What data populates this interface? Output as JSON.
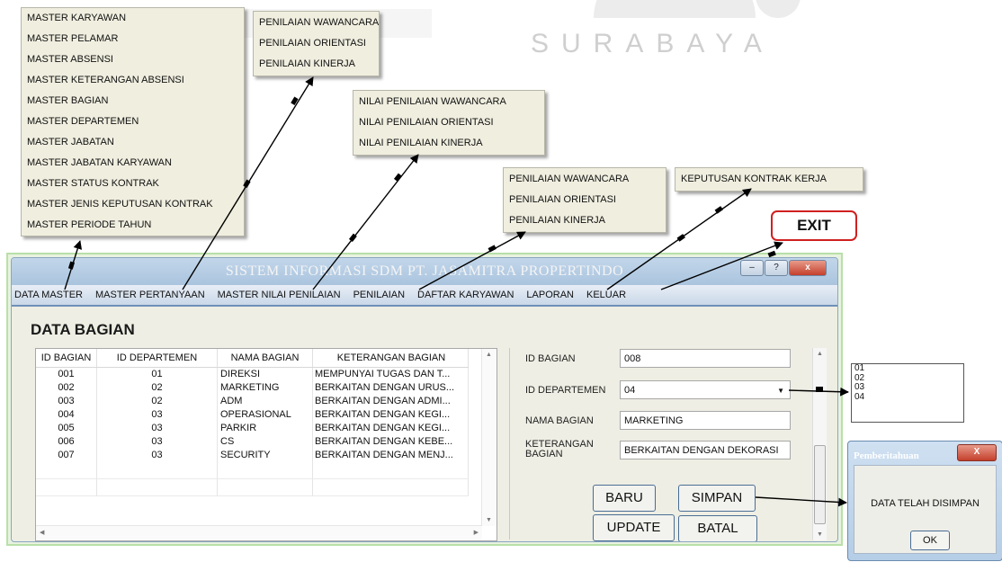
{
  "watermark": {
    "text": "SURABAYA"
  },
  "menus": {
    "master": [
      "MASTER KARYAWAN",
      "MASTER PELAMAR",
      "MASTER ABSENSI",
      "MASTER KETERANGAN ABSENSI",
      "MASTER BAGIAN",
      "MASTER DEPARTEMEN",
      "MASTER JABATAN",
      "MASTER JABATAN KARYAWAN",
      "MASTER STATUS KONTRAK",
      "MASTER JENIS KEPUTUSAN KONTRAK",
      "MASTER PERIODE TAHUN"
    ],
    "pertanyaan": [
      "PENILAIAN WAWANCARA",
      "PENILAIAN ORIENTASI",
      "PENILAIAN KINERJA"
    ],
    "nilai_penilaian": [
      "NILAI PENILAIAN WAWANCARA",
      "NILAI PENILAIAN ORIENTASI",
      "NILAI PENILAIAN KINERJA"
    ],
    "penilaian": [
      "PENILAIAN WAWANCARA",
      "PENILAIAN ORIENTASI",
      "PENILAIAN KINERJA"
    ],
    "laporan": [
      "KEPUTUSAN KONTRAK KERJA"
    ]
  },
  "exit_label": "EXIT",
  "window": {
    "title": "SISTEM INFORMASI SDM PT. JASAMITRA PROPERTINDO",
    "buttons": {
      "minimize": "–",
      "help": "?",
      "close": "x"
    },
    "menubar": [
      "DATA MASTER",
      "MASTER PERTANYAAN",
      "MASTER NILAI PENILAIAN",
      "PENILAIAN",
      "DAFTAR KARYAWAN",
      "LAPORAN",
      "KELUAR"
    ],
    "heading": "DATA BAGIAN"
  },
  "grid": {
    "columns": [
      "ID BAGIAN",
      "ID DEPARTEMEN",
      "NAMA BAGIAN",
      "KETERANGAN BAGIAN"
    ],
    "rows": [
      [
        "001",
        "01",
        "DIREKSI",
        "MEMPUNYAI TUGAS DAN T..."
      ],
      [
        "002",
        "02",
        "MARKETING",
        "BERKAITAN DENGAN URUS..."
      ],
      [
        "003",
        "02",
        "ADM",
        "BERKAITAN DENGAN ADMI..."
      ],
      [
        "004",
        "03",
        "OPERASIONAL",
        "BERKAITAN DENGAN KEGI..."
      ],
      [
        "005",
        "03",
        "PARKIR",
        "BERKAITAN DENGAN KEGI..."
      ],
      [
        "006",
        "03",
        "CS",
        "BERKAITAN DENGAN KEBE..."
      ],
      [
        "007",
        "03",
        "SECURITY",
        "BERKAITAN DENGAN MENJ..."
      ]
    ]
  },
  "form": {
    "id_bagian_label": "ID BAGIAN",
    "id_bagian_value": "008",
    "id_departemen_label": "ID DEPARTEMEN",
    "id_departemen_value": "04",
    "nama_bagian_label": "NAMA BAGIAN",
    "nama_bagian_value": "MARKETING",
    "keterangan_label_1": "KETERANGAN",
    "keterangan_label_2": "BAGIAN",
    "keterangan_value": "BERKAITAN DENGAN DEKORASI"
  },
  "buttons": {
    "baru": "BARU",
    "simpan": "SIMPAN",
    "update": "UPDATE",
    "batal": "BATAL"
  },
  "combo_options": [
    "01",
    "02",
    "03",
    "04"
  ],
  "dialog": {
    "title": "Pemberitahuan",
    "close": "X",
    "message": "DATA TELAH DISIMPAN",
    "ok": "OK"
  }
}
